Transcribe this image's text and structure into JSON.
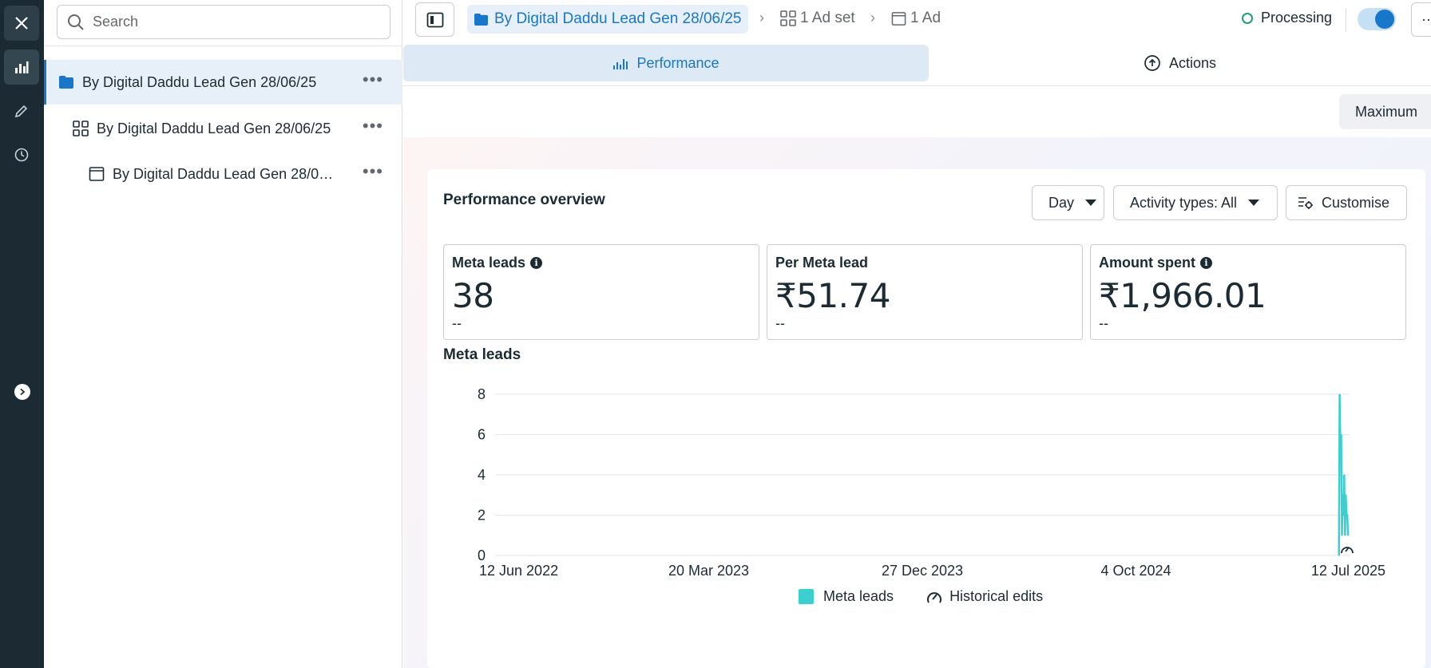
{
  "search": {
    "placeholder": "Search"
  },
  "tree": {
    "items": [
      {
        "label": "By Digital Daddu Lead Gen 28/06/25",
        "level": "campaign"
      },
      {
        "label": "By Digital Daddu Lead Gen 28/06/25",
        "level": "adset"
      },
      {
        "label": "By Digital Daddu Lead Gen 28/06…",
        "level": "ad"
      }
    ],
    "more": "•••"
  },
  "breadcrumb": {
    "campaign": "By Digital Daddu Lead Gen 28/06/25",
    "adset": "1 Ad set",
    "ad": "1 Ad",
    "separator": "›"
  },
  "status": {
    "label": "Processing",
    "toggle_on": true
  },
  "more_button": "··",
  "tabs": {
    "performance": "Performance",
    "actions": "Actions"
  },
  "date_preset": "Maximum",
  "overview": {
    "title": "Performance overview",
    "day": "Day",
    "activity": "Activity types: All",
    "customise": "Customise"
  },
  "metrics": [
    {
      "label": "Meta leads",
      "value": "38",
      "compare": "--",
      "info": "i"
    },
    {
      "label": "Per Meta lead",
      "value": "₹51.74",
      "compare": "--"
    },
    {
      "label": "Amount spent",
      "value": "₹1,966.01",
      "compare": "--",
      "info": "i"
    }
  ],
  "chart_section_title": "Meta leads",
  "legend": {
    "series": "Meta leads",
    "edits": "Historical edits"
  },
  "colors": {
    "accent": "#1877c9",
    "series": "#3ccfcf",
    "rail": "#1c2b33"
  },
  "chart_data": {
    "type": "line",
    "x_ticks": [
      "12 Jun 2022",
      "20 Mar 2023",
      "27 Dec 2023",
      "4 Oct 2024",
      "12 Jul 2025"
    ],
    "y_ticks": [
      0,
      2,
      4,
      6,
      8
    ],
    "ylim": [
      0,
      8
    ],
    "xlim": [
      "2022-06-12",
      "2025-07-12"
    ],
    "series": [
      {
        "name": "Meta leads",
        "x": [
          "2025-06-28",
          "2025-06-29",
          "2025-06-30",
          "2025-07-01",
          "2025-07-02",
          "2025-07-03",
          "2025-07-04",
          "2025-07-05",
          "2025-07-06",
          "2025-07-07",
          "2025-07-08",
          "2025-07-09",
          "2025-07-10"
        ],
        "values": [
          0,
          8,
          5,
          6,
          1,
          3,
          2,
          4,
          1,
          3,
          2,
          2,
          1
        ]
      }
    ],
    "grid": true,
    "legend_position": "bottom"
  }
}
